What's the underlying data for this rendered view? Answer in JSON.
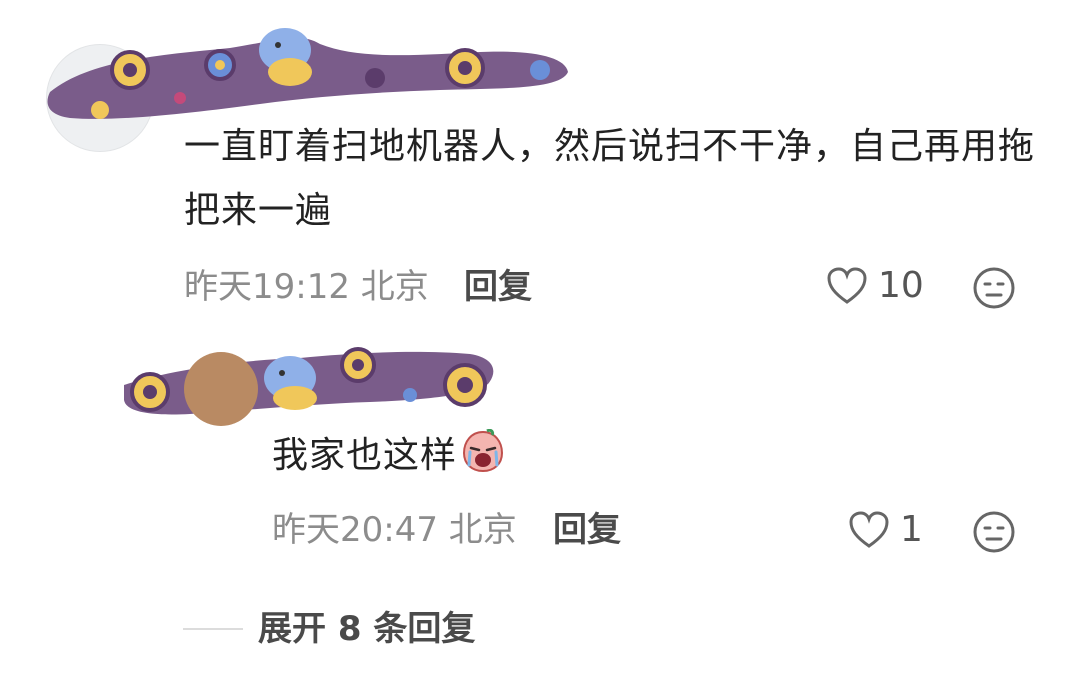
{
  "comments": [
    {
      "text": "一直盯着扫地机器人，然后说扫不干净，自己再用拖把来一遍",
      "time": "昨天19:12",
      "location": "北京",
      "reply_label": "回复",
      "likes": "10",
      "icons": {
        "like": "heart-outline-icon",
        "react": "neutral-face-icon"
      }
    },
    {
      "text": "我家也这样",
      "emoji": "crying-face-emoji",
      "time": "昨天20:47",
      "location": "北京",
      "reply_label": "回复",
      "likes": "1",
      "icons": {
        "like": "heart-outline-icon",
        "react": "neutral-face-icon"
      }
    }
  ],
  "expand_label": "展开 8 条回复",
  "colors": {
    "scribble_base": "#7a5c8a",
    "scribble_accent": "#f0c75a",
    "text": "#222222",
    "meta": "#8c8c8c"
  }
}
